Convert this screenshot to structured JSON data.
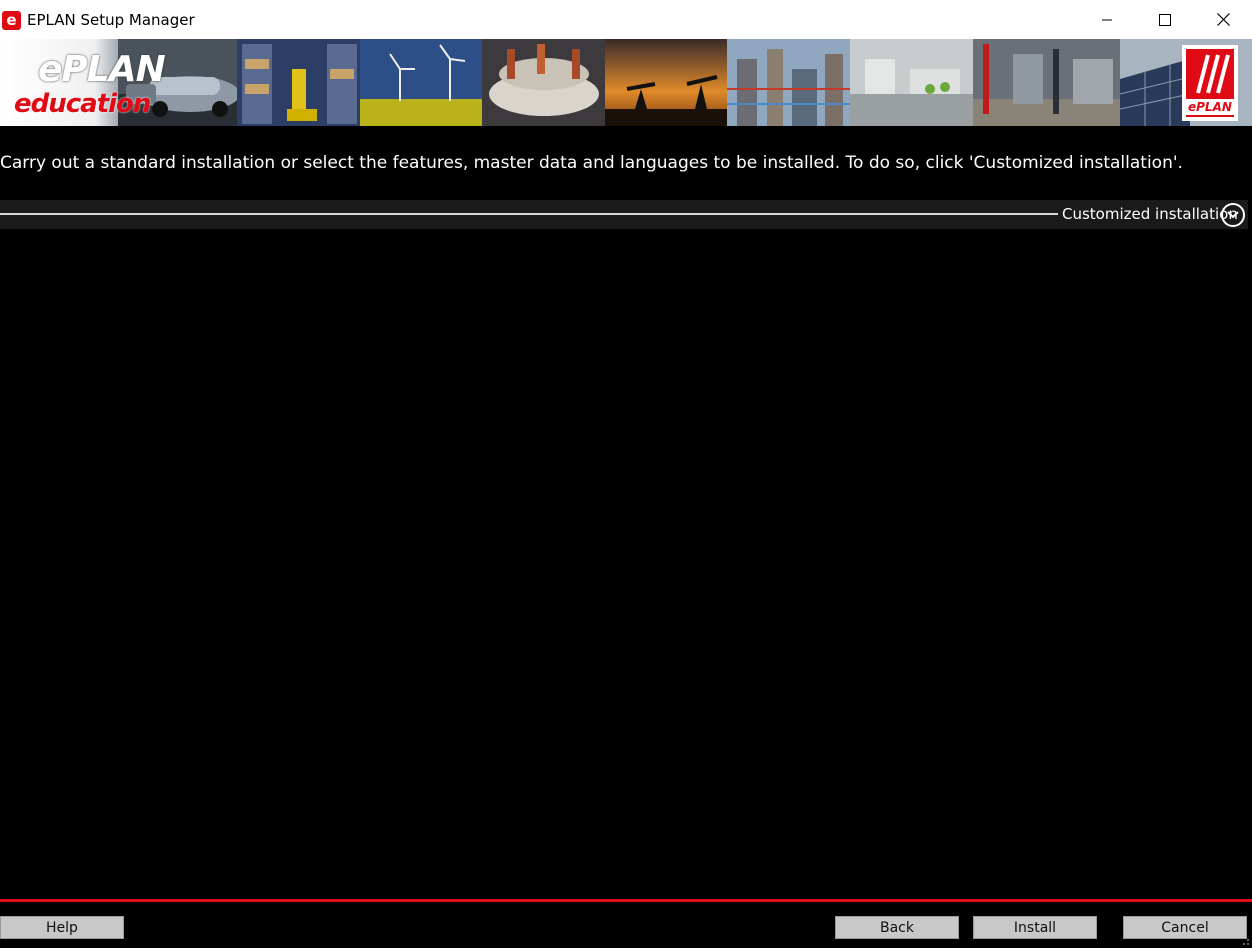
{
  "window": {
    "title": "EPLAN Setup Manager",
    "app_icon_glyph": "e",
    "controls": {
      "minimize_icon": "minimize-icon",
      "maximize_icon": "maximize-icon",
      "close_icon": "close-icon"
    }
  },
  "banner": {
    "logo_text": "ePLAN",
    "logo_subtext": "education",
    "right_logo_text": "ePLAN",
    "tiles": [
      "cars",
      "warehouse-forklift",
      "wind-turbines",
      "machine-parts",
      "oil-pumps-sunset",
      "industrial-plant",
      "automation-line",
      "power-station",
      "solar-panels"
    ]
  },
  "main": {
    "instruction": "Carry out a standard installation or select the features, master data and languages to be installed. To do so, click 'Customized installation'.",
    "customized_label": "Customized installation",
    "customized_icon": "chevron-down-icon"
  },
  "footer": {
    "help_label": "Help",
    "back_label": "Back",
    "install_label": "Install",
    "cancel_label": "Cancel"
  },
  "colors": {
    "brand_red": "#e00a14",
    "background": "#000000",
    "button_bg": "#c8c8c8"
  }
}
